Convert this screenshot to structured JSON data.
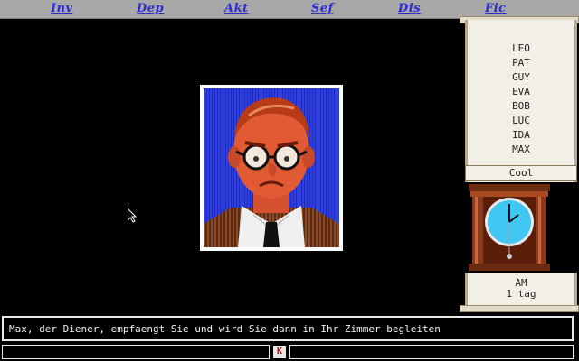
{
  "menu": {
    "items": [
      {
        "label": "Inv"
      },
      {
        "label": "Dep"
      },
      {
        "label": "Akt"
      },
      {
        "label": "Sef"
      },
      {
        "label": "Dis"
      },
      {
        "label": "Fic"
      }
    ]
  },
  "suspects": {
    "names": [
      "LEO",
      "PAT",
      "GUY",
      "EVA",
      "BOB",
      "LUC",
      "IDA",
      "MAX"
    ],
    "mood": "Cool"
  },
  "clock": {
    "icon": "wall-clock-icon",
    "face_color": "#3fc6f2",
    "case_color": "#8a3a1a"
  },
  "time": {
    "period": "AM",
    "day": "1 tag"
  },
  "dialog": {
    "text": "Max, der Diener, empfaengt Sie und wird Sie dann in Ihr Zimmer begleiten"
  },
  "status": {
    "key_label": "K"
  },
  "colors": {
    "menu_bg": "#a8a8a8",
    "menu_text": "#2b2bd8",
    "portrait_bg": "#2f3fe0"
  }
}
